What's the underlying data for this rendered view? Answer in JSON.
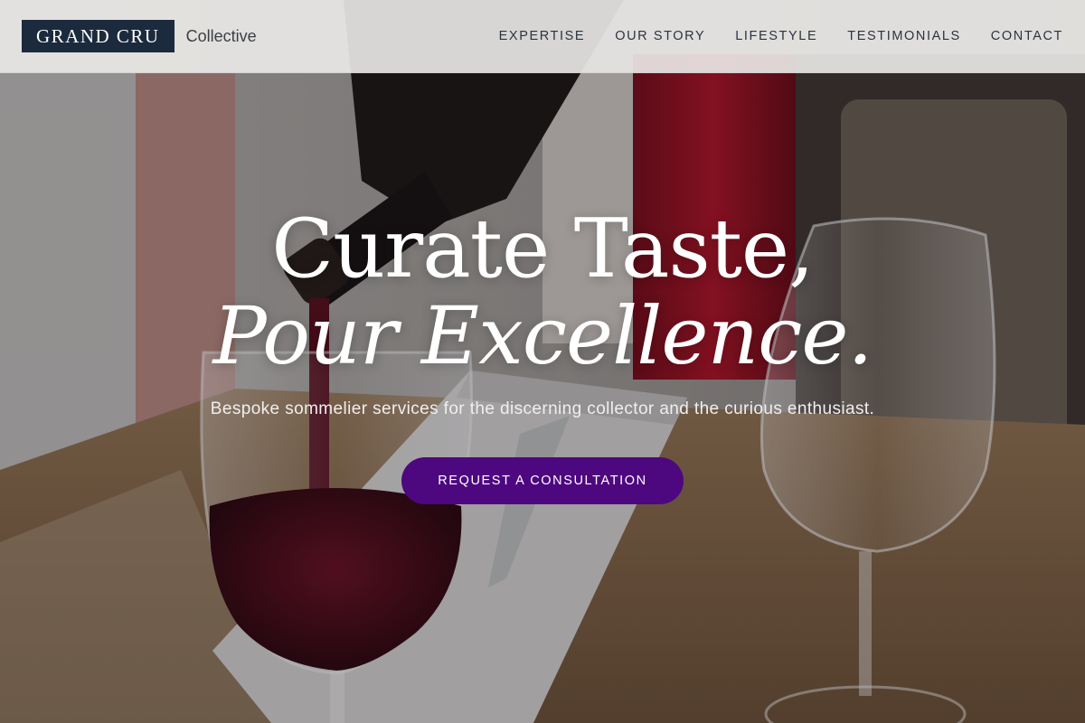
{
  "header": {
    "brand_mark": "GRAND CRU",
    "brand_sub": "Collective",
    "nav": [
      {
        "label": "EXPERTISE"
      },
      {
        "label": "OUR STORY"
      },
      {
        "label": "LIFESTYLE"
      },
      {
        "label": "TESTIMONIALS"
      },
      {
        "label": "CONTACT"
      }
    ]
  },
  "hero": {
    "headline_line1": "Curate Taste,",
    "headline_line2": "Pour Excellence.",
    "subtitle": "Bespoke sommelier services for the discerning collector and the curious enthusiast.",
    "cta_label": "REQUEST A CONSULTATION"
  },
  "colors": {
    "brand_mark_bg": "#1c2a3e",
    "cta_bg": "#4d077f",
    "header_bg": "#ecebe9"
  }
}
